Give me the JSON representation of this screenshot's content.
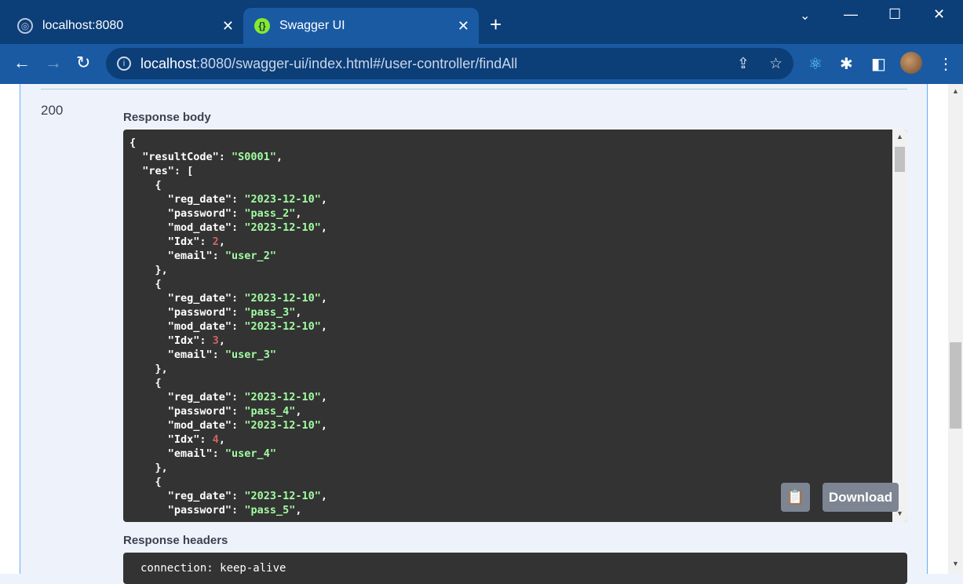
{
  "browser": {
    "tabs": [
      {
        "title": "localhost:8080",
        "active": false
      },
      {
        "title": "Swagger UI",
        "active": true
      }
    ],
    "url_host": "localhost",
    "url_rest": ":8080/swagger-ui/index.html#/user-controller/findAll"
  },
  "response": {
    "status_code": "200",
    "body_label": "Response body",
    "headers_label": "Response headers",
    "headers_preview": "connection: keep-alive",
    "download_label": "Download",
    "body": {
      "resultCode": "S0001",
      "res": [
        {
          "reg_date": "2023-12-10",
          "password": "pass_2",
          "mod_date": "2023-12-10",
          "Idx": 2,
          "email": "user_2"
        },
        {
          "reg_date": "2023-12-10",
          "password": "pass_3",
          "mod_date": "2023-12-10",
          "Idx": 3,
          "email": "user_3"
        },
        {
          "reg_date": "2023-12-10",
          "password": "pass_4",
          "mod_date": "2023-12-10",
          "Idx": 4,
          "email": "user_4"
        },
        {
          "reg_date": "2023-12-10",
          "password": "pass_5"
        }
      ]
    }
  },
  "colors": {
    "swagger_accent": "#61affe",
    "code_bg": "#333333",
    "string": "#a2fca2",
    "number": "#d36363"
  }
}
